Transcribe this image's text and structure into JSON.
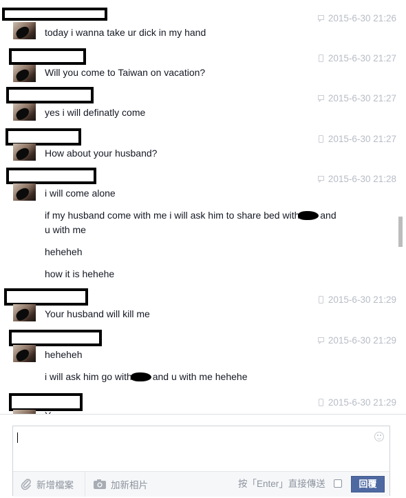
{
  "thread": {
    "groups": [
      {
        "time": "2015-6-30 21:26",
        "device": "chat",
        "lines": [
          {
            "text": "today i wanna take ur dick in my hand"
          }
        ]
      },
      {
        "time": "2015-6-30 21:27",
        "device": "mobile",
        "lines": [
          {
            "text": "Will you come to Taiwan on vacation?"
          }
        ]
      },
      {
        "time": "2015-6-30 21:27",
        "device": "chat",
        "lines": [
          {
            "text": "yes i will definatly come"
          }
        ]
      },
      {
        "time": "2015-6-30 21:27",
        "device": "mobile",
        "lines": [
          {
            "text": "How about your husband?"
          }
        ]
      },
      {
        "time": "2015-6-30 21:28",
        "device": "chat",
        "lines": [
          {
            "text": "i will come alone"
          },
          {
            "before": "if my husband come with me i will ask him to share bed with",
            "after": " and"
          },
          {
            "text": "u with me"
          },
          {
            "text": "heheheh"
          },
          {
            "text": "how it is hehehe"
          }
        ]
      },
      {
        "time": "2015-6-30 21:29",
        "device": "mobile",
        "lines": [
          {
            "text": "Your husband will kill me"
          }
        ]
      },
      {
        "time": "2015-6-30 21:29",
        "device": "chat",
        "lines": [
          {
            "text": "heheheh"
          },
          {
            "before": "i will ask him go with",
            "after": " and u with me hehehe"
          }
        ]
      },
      {
        "time": "2015-6-30 21:29",
        "device": "mobile",
        "lines": [
          {
            "text": "Y"
          }
        ]
      }
    ]
  },
  "composer": {
    "attach_label": "新增檔案",
    "photo_label": "加新相片",
    "enter_label": "按「Enter」直接傳送",
    "send_on_enter": false,
    "reply_label": "回覆"
  }
}
